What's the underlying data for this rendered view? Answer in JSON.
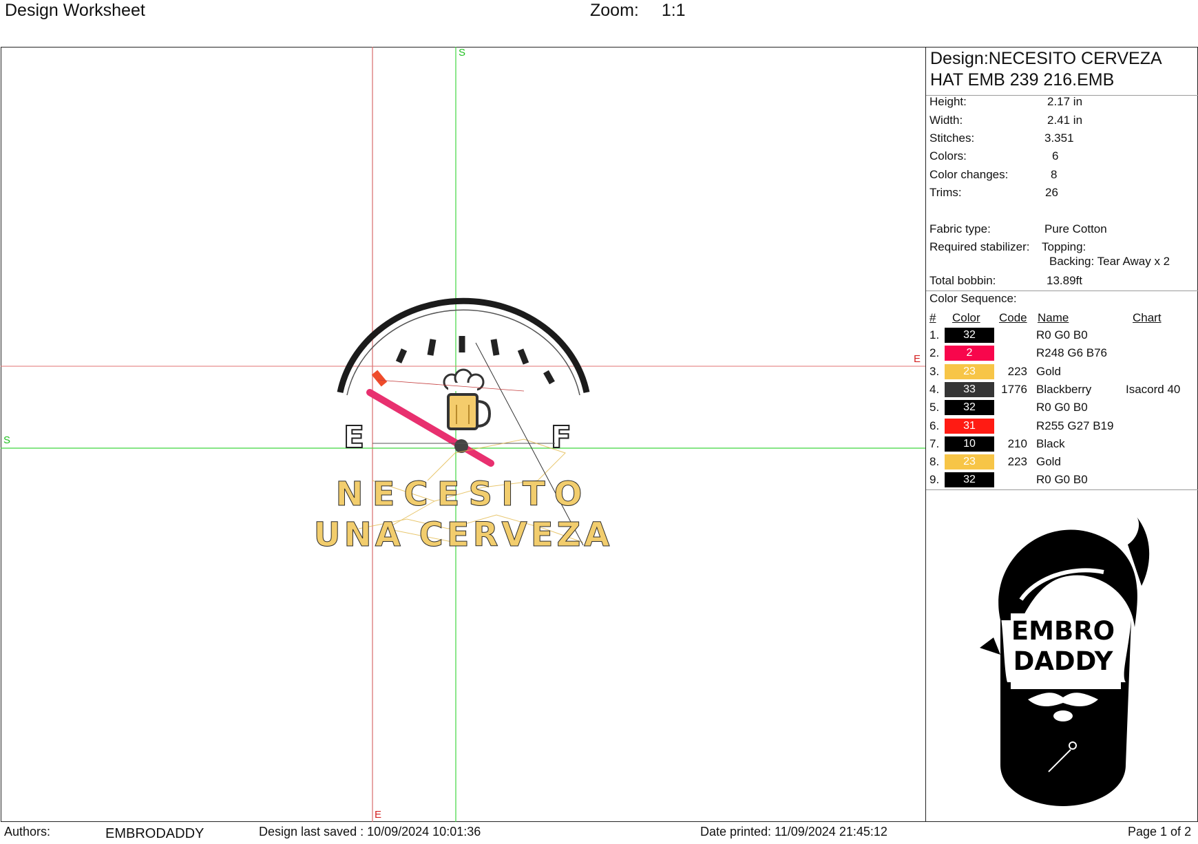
{
  "header": {
    "title": "Design Worksheet",
    "zoom_label": "Zoom:",
    "zoom_value": "1:1"
  },
  "canvas": {
    "guide_labels": {
      "top": "S",
      "left": "S",
      "right": "E",
      "bottom": "E"
    },
    "design_text": {
      "line1": "NECESITO",
      "line2": "UNA CERVEZA",
      "left_mark": "E",
      "right_mark": "F"
    }
  },
  "design": {
    "title_line1": "Design:NECESITO CERVEZA",
    "title_line2": "HAT EMB 239 216.EMB"
  },
  "properties": {
    "height": {
      "label": "Height:",
      "value": "2.17 in"
    },
    "width": {
      "label": "Width:",
      "value": "2.41 in"
    },
    "stitches": {
      "label": "Stitches:",
      "value": "3.351"
    },
    "colors": {
      "label": "Colors:",
      "value": "6"
    },
    "color_changes": {
      "label": "Color changes:",
      "value": "8"
    },
    "trims": {
      "label": "Trims:",
      "value": "26"
    },
    "fabric": {
      "label": "Fabric type:",
      "value": "Pure Cotton"
    },
    "stabilizer": {
      "label": "Required stabilizer:",
      "topping": "Topping:",
      "backing": "Backing: Tear Away x 2"
    },
    "bobbin": {
      "label": "Total bobbin:",
      "value": "13.89ft"
    }
  },
  "color_sequence": {
    "label": "Color Sequence:",
    "headers": {
      "num": "#",
      "color": "Color",
      "code": "Code",
      "name": "Name",
      "chart": "Chart"
    },
    "rows": [
      {
        "n": "1.",
        "swatch": "32",
        "hex": "#000000",
        "code": "",
        "name": "R0 G0 B0",
        "chart": ""
      },
      {
        "n": "2.",
        "swatch": "2",
        "hex": "#f8064c",
        "code": "",
        "name": "R248 G6 B76",
        "chart": ""
      },
      {
        "n": "3.",
        "swatch": "23",
        "hex": "#f7c547",
        "code": "223",
        "name": "Gold",
        "chart": ""
      },
      {
        "n": "4.",
        "swatch": "33",
        "hex": "#353535",
        "code": "1776",
        "name": "Blackberry",
        "chart": "Isacord 40"
      },
      {
        "n": "5.",
        "swatch": "32",
        "hex": "#000000",
        "code": "",
        "name": "R0 G0 B0",
        "chart": ""
      },
      {
        "n": "6.",
        "swatch": "31",
        "hex": "#ff1b13",
        "code": "",
        "name": "R255 G27 B19",
        "chart": ""
      },
      {
        "n": "7.",
        "swatch": "10",
        "hex": "#000000",
        "code": "210",
        "name": "Black",
        "chart": ""
      },
      {
        "n": "8.",
        "swatch": "23",
        "hex": "#f7c547",
        "code": "223",
        "name": "Gold",
        "chart": ""
      },
      {
        "n": "9.",
        "swatch": "32",
        "hex": "#000000",
        "code": "",
        "name": "R0 G0 B0",
        "chart": ""
      }
    ]
  },
  "logo": {
    "line1": "EMBRO",
    "line2": "DADDY"
  },
  "footer": {
    "authors_label": "Authors:",
    "authors_value": "EMBRODADDY",
    "saved": "Design last saved : 10/09/2024 10:01:36",
    "printed": "Date printed: 11/09/2024 21:45:12",
    "page": "Page 1 of 2"
  }
}
